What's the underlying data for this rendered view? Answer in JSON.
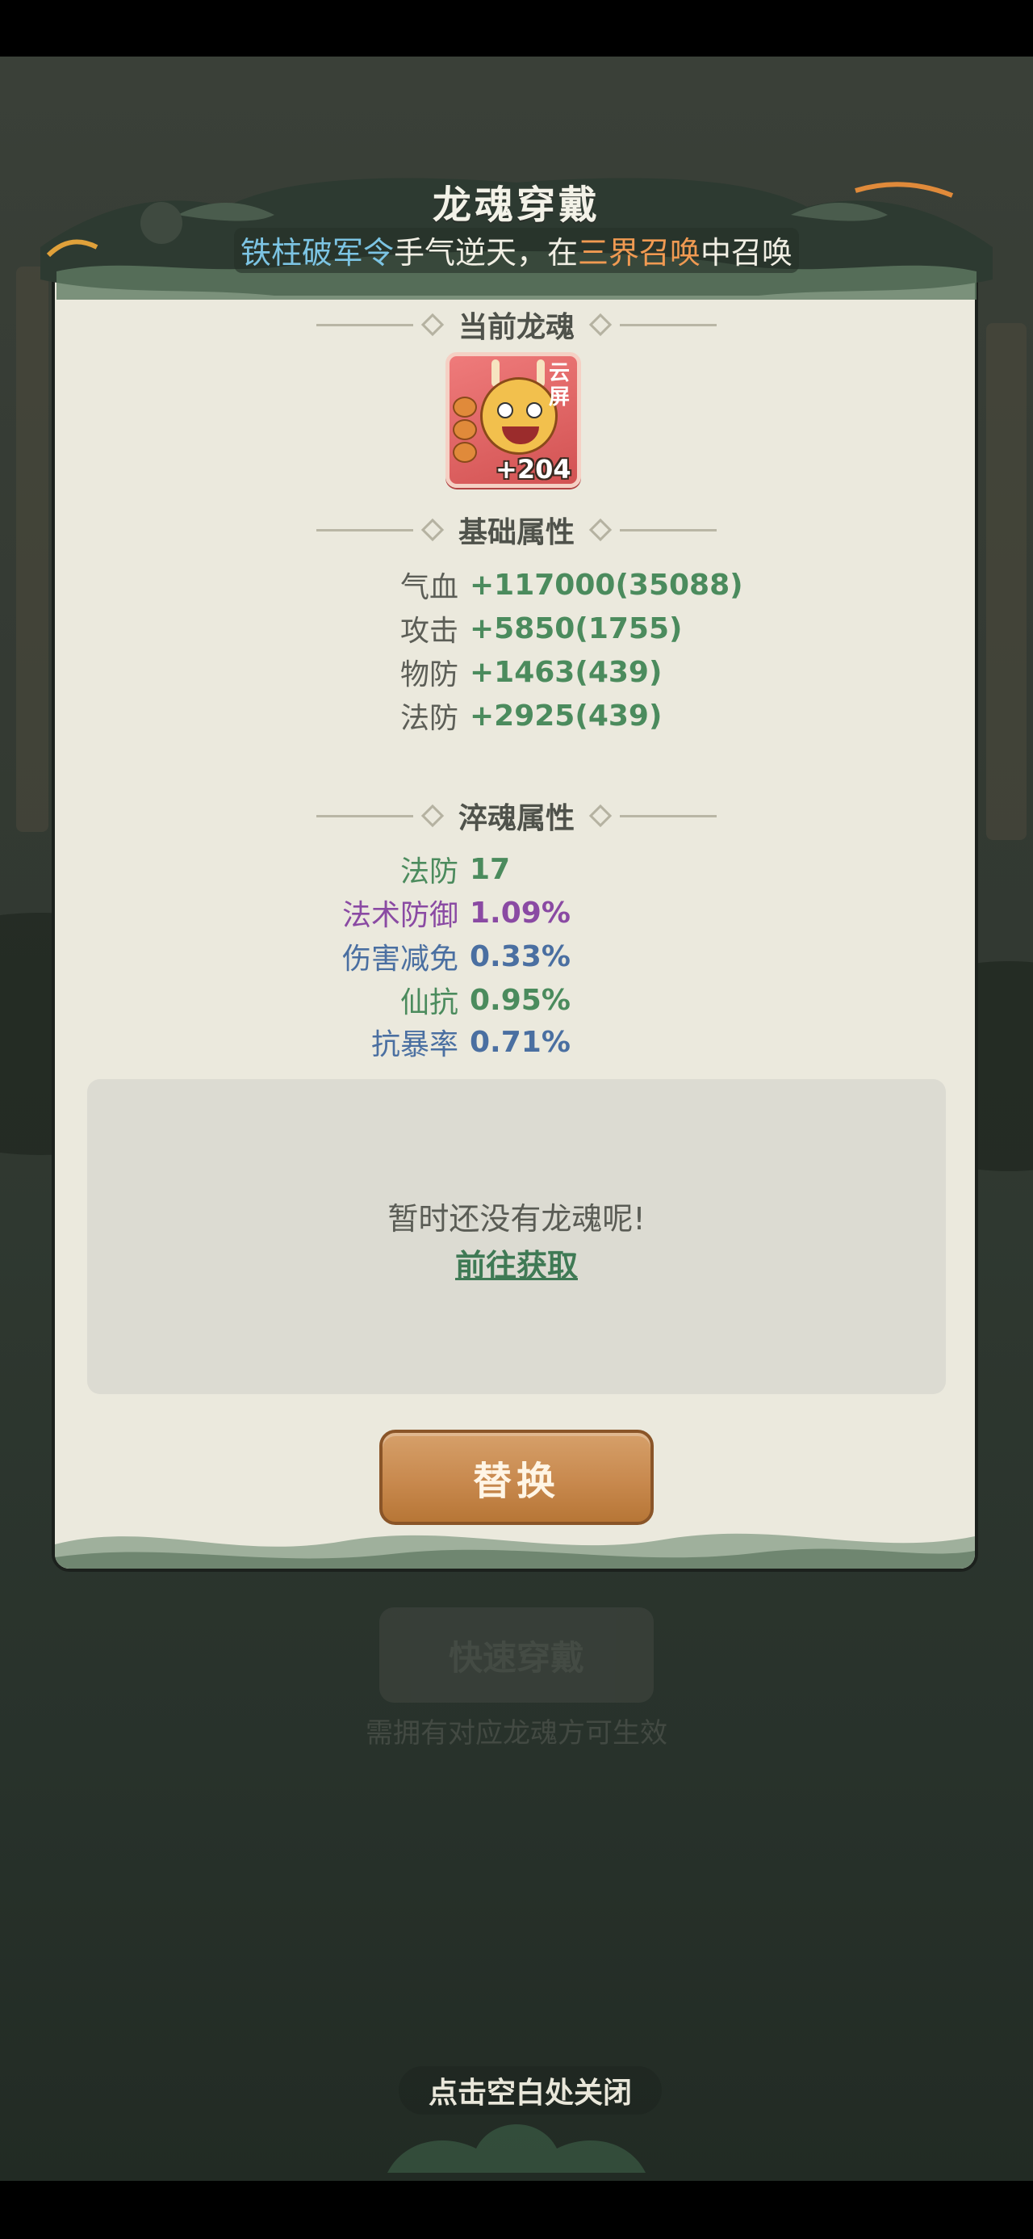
{
  "header": {
    "title": "龙魂穿戴",
    "subtitle_parts": [
      {
        "text": "铁柱破军令",
        "style": "blue"
      },
      {
        "text": "手气逆天，在",
        "style": "plain"
      },
      {
        "text": "三界召唤",
        "style": "orange"
      },
      {
        "text": "中召唤",
        "style": "plain"
      }
    ]
  },
  "sections": {
    "current": "当前龙魂",
    "base": "基础属性",
    "temper": "淬魂属性"
  },
  "dragon_soul": {
    "tag": "云屏",
    "count": "+204",
    "icon": "dragon-soul-icon"
  },
  "base_stats": [
    {
      "label": "气血",
      "value": "+117000(35088)"
    },
    {
      "label": "攻击",
      "value": "+5850(1755)"
    },
    {
      "label": "物防",
      "value": "+1463(439)"
    },
    {
      "label": "法防",
      "value": "+2925(439)"
    }
  ],
  "temper_stats": [
    {
      "label": "法防",
      "value": "17",
      "color": "green"
    },
    {
      "label": "法术防御",
      "value": "1.09%",
      "color": "purple"
    },
    {
      "label": "伤害减免",
      "value": "0.33%",
      "color": "blue"
    },
    {
      "label": "仙抗",
      "value": "0.95%",
      "color": "green"
    },
    {
      "label": "抗暴率",
      "value": "0.71%",
      "color": "blue"
    }
  ],
  "empty": {
    "message": "暂时还没有龙魂呢!",
    "link": "前往获取"
  },
  "buttons": {
    "replace": "替换",
    "quick_wear": "快速穿戴",
    "quick_wear_hint": "需拥有对应龙魂方可生效"
  },
  "close_hint": "点击空白处关闭",
  "colors": {
    "panel_bg": "#ebe9dd",
    "accent_green": "#4b8b5d",
    "accent_purple": "#8a4aa3",
    "accent_blue": "#4a6fa1",
    "button_brown": "#c8894e"
  }
}
